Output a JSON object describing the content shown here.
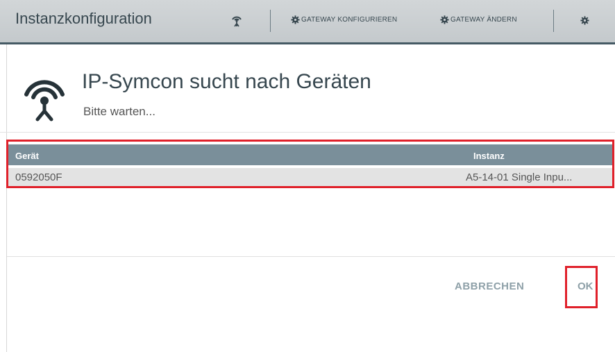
{
  "window": {
    "title": "Instanzkonfiguration",
    "buttons": [
      "GATEWAY KONFIGURIEREN",
      "GATEWAY ÄNDERN"
    ]
  },
  "dialog": {
    "heading": "IP-Symcon sucht nach Geräten",
    "status": "Bitte warten...",
    "table": {
      "columns": [
        "Gerät",
        "Instanz"
      ],
      "rows": [
        [
          "0592050F",
          "A5-14-01 Single Inpu..."
        ]
      ]
    },
    "actions": {
      "cancel": "ABBRECHEN",
      "ok": "OK"
    }
  },
  "colors": {
    "highlight": "#e0202a",
    "header_bg": "#7a8f9a",
    "accent_text": "#37474f"
  },
  "icons": [
    "antenna-icon",
    "gear-icon",
    "wifi-search-icon"
  ]
}
